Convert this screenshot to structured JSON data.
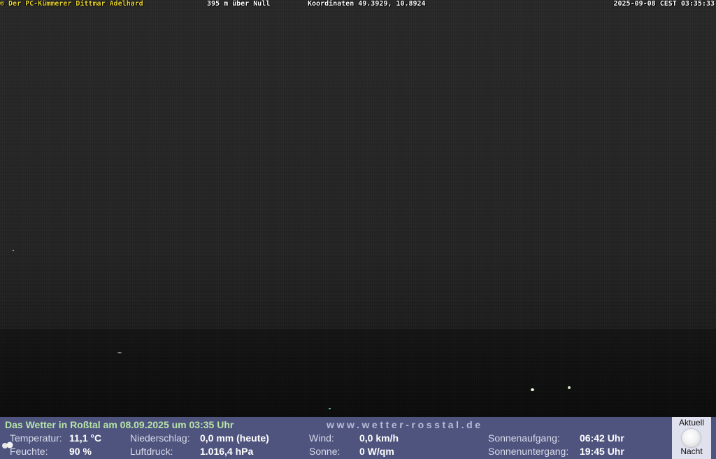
{
  "overlay": {
    "credit": "© Der PC-Kümmerer Dittmar Adelhard",
    "altitude": "395 m über Null",
    "coordinates": "Koordinaten 49.3929, 10.8924",
    "timestamp": "2025-09-08 CEST 03:35:33"
  },
  "weather": {
    "title": "Das Wetter in Roßtal am 08.09.2025 um 03:35 Uhr",
    "url": "www.wetter-rosstal.de",
    "temperature_label": "Temperatur:",
    "temperature_value": "11,1 °C",
    "humidity_label": "Feuchte:",
    "humidity_value": "90 %",
    "precip_label": "Niederschlag:",
    "precip_value": "0,0 mm (heute)",
    "pressure_label": "Luftdruck:",
    "pressure_value": "1.016,4 hPa",
    "wind_label": "Wind:",
    "wind_value": "0,0 km/h",
    "sun_label": "Sonne:",
    "sun_value": "0 W/qm",
    "sunrise_label": "Sonnenaufgang:",
    "sunrise_value": "06:42 Uhr",
    "sunset_label": "Sonnenuntergang:",
    "sunset_value": "19:45 Uhr"
  },
  "moon": {
    "top_label": "Aktuell",
    "bottom_label": "Nacht",
    "icon": "moon-icon"
  },
  "colors": {
    "bar_background": "#4f547f",
    "title_green": "#b7e4a7",
    "credit_yellow": "#e8d431"
  }
}
